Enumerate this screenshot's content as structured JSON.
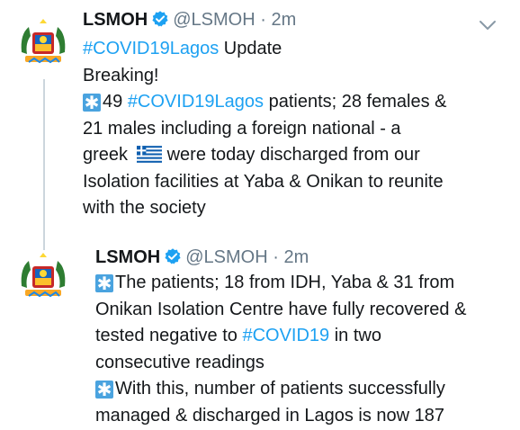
{
  "tweets": [
    {
      "name": "LSMOH",
      "handle": "@LSMOH",
      "separator": "·",
      "time": "2m",
      "lines": [
        [
          "#COVID19Lagos",
          " Update"
        ],
        [
          "Breaking!"
        ],
        [
          "✱",
          "49 ",
          "#COVID19Lagos",
          " patients; 28 females &"
        ],
        [
          "21 males including a foreign national - a"
        ],
        [
          "greek ",
          "flag",
          "were today discharged from our"
        ],
        [
          "Isolation facilities at Yaba & Onikan to reunite"
        ],
        [
          "with the society"
        ]
      ]
    },
    {
      "name": "LSMOH",
      "handle": "@LSMOH",
      "separator": "·",
      "time": "2m",
      "lines": [
        [
          "✱",
          "The patients; 18 from IDH, Yaba & 31 from"
        ],
        [
          "Onikan Isolation Centre have fully recovered &"
        ],
        [
          "tested negative to ",
          "#COVID19",
          " in two"
        ],
        [
          "consecutive readings"
        ],
        [
          "✱",
          "With this, number of patients successfully"
        ],
        [
          "managed & discharged in Lagos is now 187"
        ]
      ]
    }
  ],
  "icons": {
    "verified": "verified-badge-icon",
    "chevron": "chevron-down-icon",
    "flag": "greece-flag-icon",
    "star": "eight-spoked-asterisk-icon"
  },
  "colors": {
    "link": "#1da1f2",
    "verified": "#1da1f2",
    "muted": "#657786",
    "star_box": "#4aa3df",
    "thread_line": "#ccd6dd"
  }
}
